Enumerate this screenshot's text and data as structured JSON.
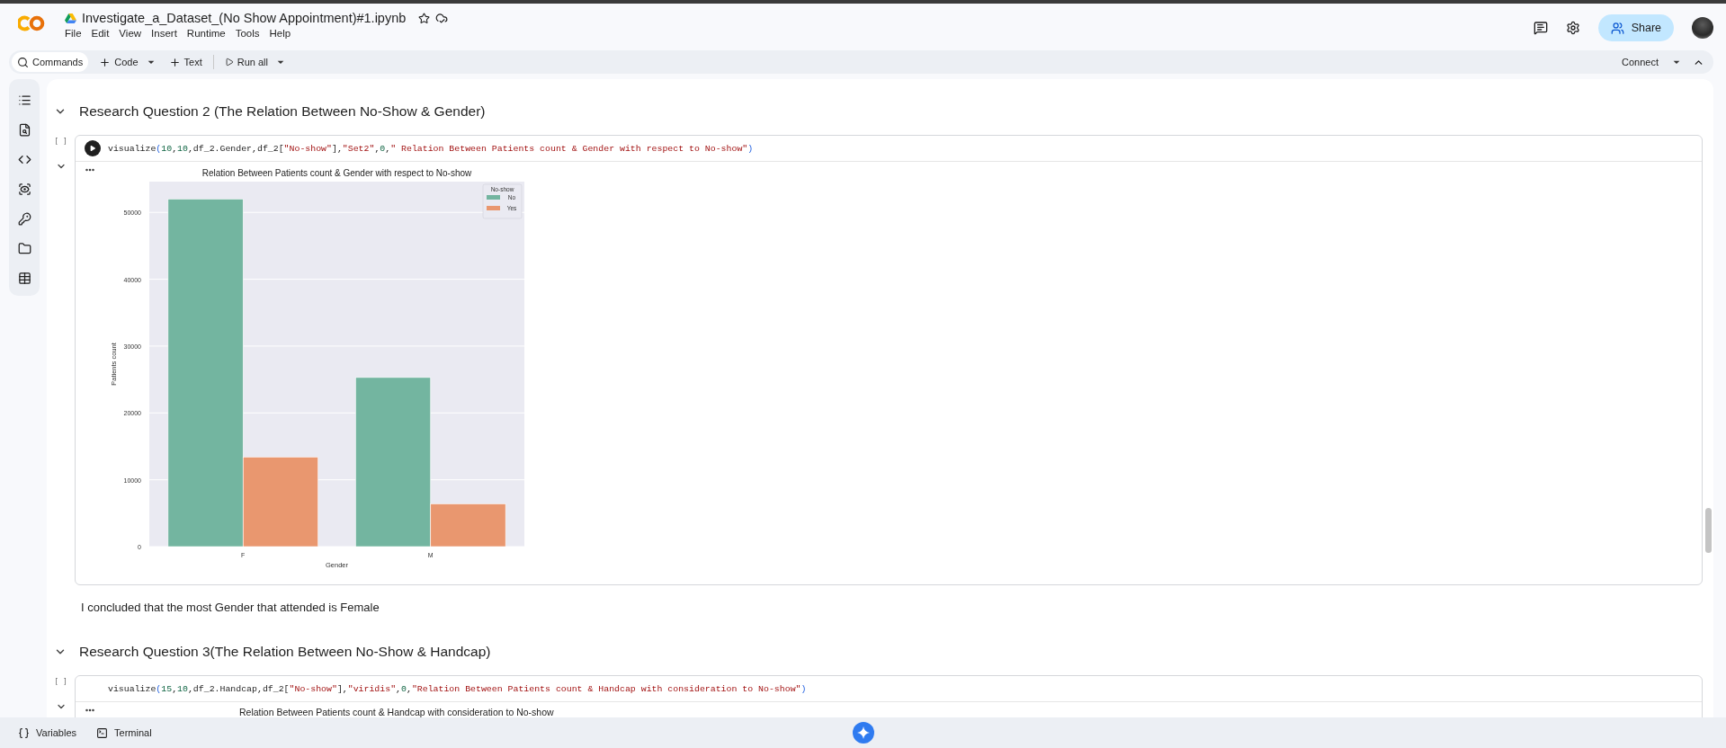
{
  "header": {
    "title": "Investigate_a_Dataset_(No Show Appointment)#1.ipynb",
    "menu": [
      "File",
      "Edit",
      "View",
      "Insert",
      "Runtime",
      "Tools",
      "Help"
    ],
    "share": "Share"
  },
  "toolbar": {
    "commands": "Commands",
    "add_code": "Code",
    "add_text": "Text",
    "run_all": "Run all",
    "connect": "Connect"
  },
  "cells": [
    {
      "kind": "heading",
      "text": "Research Question 2 (The Relation Between No-Show & Gender)"
    },
    {
      "kind": "code",
      "exec_count": "[ ]",
      "focused": true,
      "tokens": [
        {
          "kind": "plain",
          "text": "visualize"
        },
        {
          "kind": "paren",
          "text": "("
        },
        {
          "kind": "num",
          "text": "10"
        },
        {
          "kind": "plain",
          "text": ","
        },
        {
          "kind": "num",
          "text": "10"
        },
        {
          "kind": "plain",
          "text": ",df_2.Gender,df_2["
        },
        {
          "kind": "str",
          "text": "\"No-show\""
        },
        {
          "kind": "plain",
          "text": "],"
        },
        {
          "kind": "str",
          "text": "\"Set2\""
        },
        {
          "kind": "plain",
          "text": ","
        },
        {
          "kind": "num",
          "text": "0"
        },
        {
          "kind": "plain",
          "text": ","
        },
        {
          "kind": "str",
          "text": "\" Relation Between Patients count & Gender with respect to No-show\""
        },
        {
          "kind": "paren",
          "text": ")"
        }
      ],
      "output": {
        "kind": "chart",
        "chart_data": {
          "type": "bar",
          "grid": true,
          "legend": {
            "title": "No-show"
          },
          "title": "Relation Between Patients count & Gender with respect to No-show",
          "xlabel": "Gender",
          "ylabel": "Patients count",
          "categories": [
            "F",
            "M"
          ],
          "series": [
            {
              "name": "No",
              "color": "#73b5a0",
              "values": [
                52000,
                25300
              ]
            },
            {
              "name": "Yes",
              "color": "#e9976f",
              "values": [
                13400,
                6400
              ]
            }
          ],
          "ylim": [
            0,
            54600
          ],
          "yticks": [
            0,
            10000,
            20000,
            30000,
            40000,
            50000
          ]
        }
      }
    },
    {
      "kind": "markdown",
      "text": "I concluded that the most Gender that attended is Female"
    },
    {
      "kind": "heading",
      "text": "Research Question 3(The Relation Between No-Show & Handcap)"
    },
    {
      "kind": "code",
      "exec_count": "[ ]",
      "focused": false,
      "tokens": [
        {
          "kind": "plain",
          "text": "visualize"
        },
        {
          "kind": "paren",
          "text": "("
        },
        {
          "kind": "num",
          "text": "15"
        },
        {
          "kind": "plain",
          "text": ","
        },
        {
          "kind": "num",
          "text": "10"
        },
        {
          "kind": "plain",
          "text": ",df_2.Handcap,df_2["
        },
        {
          "kind": "str",
          "text": "\"No-show\""
        },
        {
          "kind": "plain",
          "text": "],"
        },
        {
          "kind": "str",
          "text": "\"viridis\""
        },
        {
          "kind": "plain",
          "text": ","
        },
        {
          "kind": "num",
          "text": "0"
        },
        {
          "kind": "plain",
          "text": ","
        },
        {
          "kind": "str",
          "text": "\"Relation Between Patients count & Handcap with consideration to No-show\""
        },
        {
          "kind": "paren",
          "text": ")"
        }
      ],
      "output": {
        "kind": "title",
        "text": "Relation Between Patients count & Handcap with consideration to No-show"
      }
    }
  ],
  "status_bar": [
    {
      "kind": "variables",
      "label": "Variables"
    },
    {
      "kind": "terminal",
      "label": "Terminal"
    }
  ]
}
